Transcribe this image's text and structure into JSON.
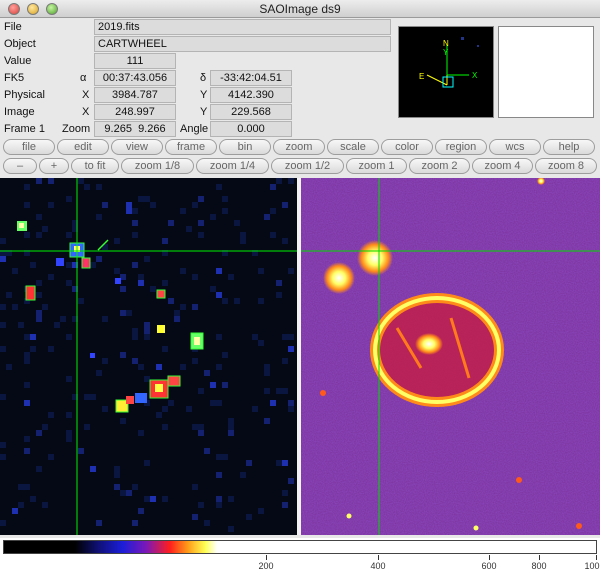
{
  "window": {
    "title": "SAOImage ds9"
  },
  "info": {
    "file": {
      "label": "File",
      "value": "2019.fits"
    },
    "object": {
      "label": "Object",
      "value": "CARTWHEEL"
    },
    "value": {
      "label": "Value",
      "value": "111"
    },
    "fk5": {
      "label": "FK5",
      "alpha": "α",
      "alpha_value": "00:37:43.056",
      "delta": "δ",
      "delta_value": "-33:42:04.51"
    },
    "physical": {
      "label": "Physical",
      "x_label": "X",
      "x_value": "3984.787",
      "y_label": "Y",
      "y_value": "4142.390"
    },
    "image": {
      "label": "Image",
      "x_label": "X",
      "x_value": "248.997",
      "y_label": "Y",
      "y_value": "229.568"
    },
    "frame": {
      "label": "Frame 1",
      "zoom_label": "Zoom",
      "zoom_x": "9.265",
      "zoom_y": "9.266",
      "angle_label": "Angle",
      "angle_value": "0.000"
    }
  },
  "panner": {
    "label_n": "N",
    "label_e": "E",
    "label_y": "Y",
    "label_x": "X"
  },
  "menu_buttons": [
    "file",
    "edit",
    "view",
    "frame",
    "bin",
    "zoom",
    "scale",
    "color",
    "region",
    "wcs",
    "help"
  ],
  "zoom_buttons": [
    "–",
    "+",
    "to fit",
    "zoom 1/8",
    "zoom 1/4",
    "zoom 1/2",
    "zoom 1",
    "zoom 2",
    "zoom 4",
    "zoom 8"
  ],
  "colorbar": {
    "ticks": [
      "200",
      "400",
      "600",
      "800",
      "100"
    ]
  }
}
